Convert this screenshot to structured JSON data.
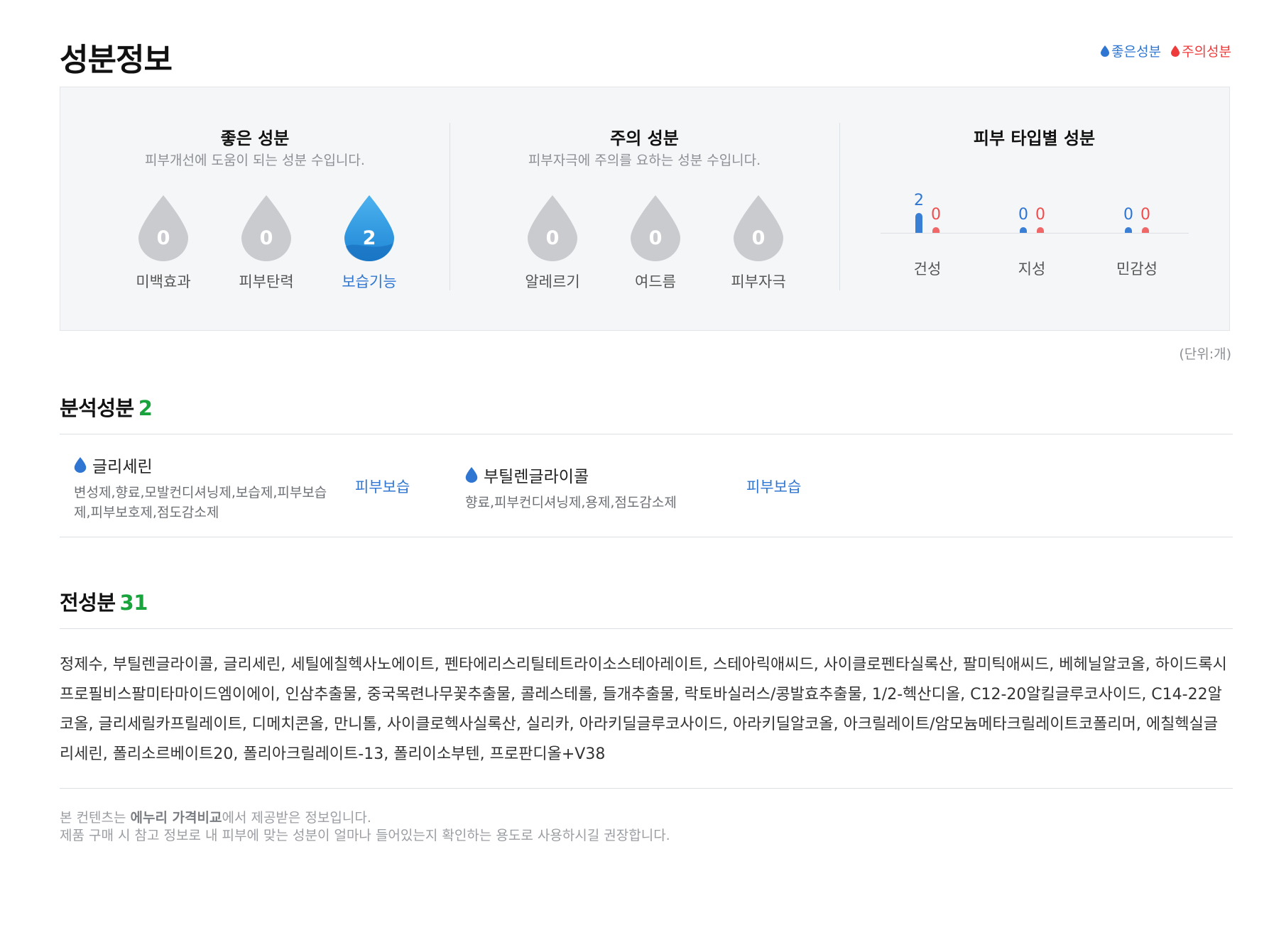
{
  "header": {
    "title": "성분정보",
    "legend_good": "좋은성분",
    "legend_caution": "주의성분"
  },
  "colors": {
    "good": "#2f76d2",
    "caution": "#ee3b3b",
    "count_green": "#19a33d",
    "drop_inactive": "#c9cbcf"
  },
  "good_section": {
    "title": "좋은 성분",
    "subtitle": "피부개선에 도움이 되는 성분 수입니다.",
    "items": [
      {
        "label": "미백효과",
        "value": "0",
        "active": false
      },
      {
        "label": "피부탄력",
        "value": "0",
        "active": false
      },
      {
        "label": "보습기능",
        "value": "2",
        "active": true
      }
    ]
  },
  "caution_section": {
    "title": "주의 성분",
    "subtitle": "피부자극에 주의를 요하는 성분 수입니다.",
    "items": [
      {
        "label": "알레르기",
        "value": "0",
        "active": false
      },
      {
        "label": "여드름",
        "value": "0",
        "active": false
      },
      {
        "label": "피부자극",
        "value": "0",
        "active": false
      }
    ]
  },
  "skin_type_section": {
    "title": "피부 타입별 성분",
    "chart_data": {
      "type": "bar",
      "categories": [
        "건성",
        "지성",
        "민감성"
      ],
      "series": [
        {
          "name": "좋은성분",
          "values": [
            2,
            0,
            0
          ]
        },
        {
          "name": "주의성분",
          "values": [
            0,
            0,
            0
          ]
        }
      ]
    }
  },
  "unit_note": "(단위:개)",
  "analysis": {
    "title": "분석성분",
    "count": "2",
    "ingredients": [
      {
        "name": "글리세린",
        "functions": "변성제,향료,모발컨디셔닝제,보습제,피부보습제,피부보호제,점도감소제",
        "tag": "피부보습"
      },
      {
        "name": "부틸렌글라이콜",
        "functions": "향료,피부컨디셔닝제,용제,점도감소제",
        "tag": "피부보습"
      }
    ]
  },
  "full_ingredients": {
    "title": "전성분",
    "count": "31",
    "text": "정제수, 부틸렌글라이콜, 글리세린, 세틸에칠헥사노에이트, 펜타에리스리틸테트라이소스테아레이트, 스테아릭애씨드, 사이클로펜타실록산, 팔미틱애씨드, 베헤닐알코올, 하이드록시프로필비스팔미타마이드엠이에이, 인삼추출물, 중국목련나무꽃추출물, 콜레스테롤, 들개추출물, 락토바실러스/콩발효추출물, 1/2-헥산디올, C12-20알킬글루코사이드, C14-22알코올, 글리세릴카프릴레이트, 디메치콘올, 만니톨, 사이클로헥사실록산, 실리카, 아라키딜글루코사이드, 아라키딜알코올, 아크릴레이트/암모늄메타크릴레이트코폴리머, 에칠헥실글리세린, 폴리소르베이트20, 폴리아크릴레이트-13, 폴리이소부텐, 프로판디올+V38"
  },
  "footer": {
    "line1_prefix": "본 컨텐츠는 ",
    "line1_bold": "에누리 가격비교",
    "line1_suffix": "에서 제공받은 정보입니다.",
    "line2": "제품 구매 시 참고 정보로 내 피부에 맞는 성분이 얼마나 들어있는지 확인하는 용도로 사용하시길 권장합니다."
  }
}
